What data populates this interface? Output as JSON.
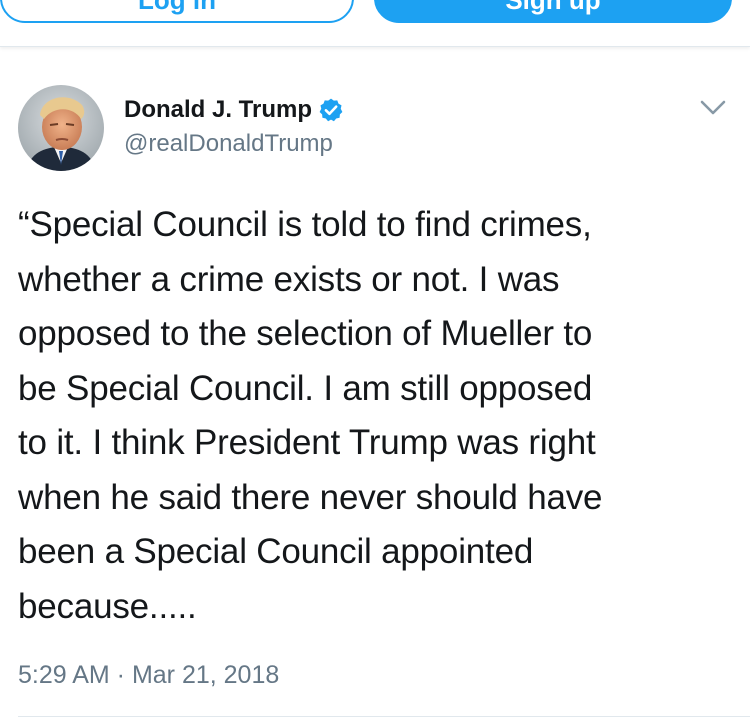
{
  "header": {
    "login_label": "Log in",
    "signup_label": "Sign up"
  },
  "tweet": {
    "display_name": "Donald J. Trump",
    "handle": "@realDonaldTrump",
    "verified_icon": "verified-badge-icon",
    "menu_icon": "chevron-down-icon",
    "text": "“Special Council is told to find crimes,\nwhether a crime exists or not. I was\nopposed to the selection of Mueller to\nbe Special Council. I am still opposed\nto it. I think President Trump was right\nwhen he said there never should have\nbeen a Special Council appointed\nbecause.....",
    "timestamp": "5:29 AM · Mar 21, 2018"
  },
  "colors": {
    "accent": "#1da1f2",
    "text": "#14171a",
    "secondary": "#657786",
    "divider": "#e1e8ed"
  }
}
